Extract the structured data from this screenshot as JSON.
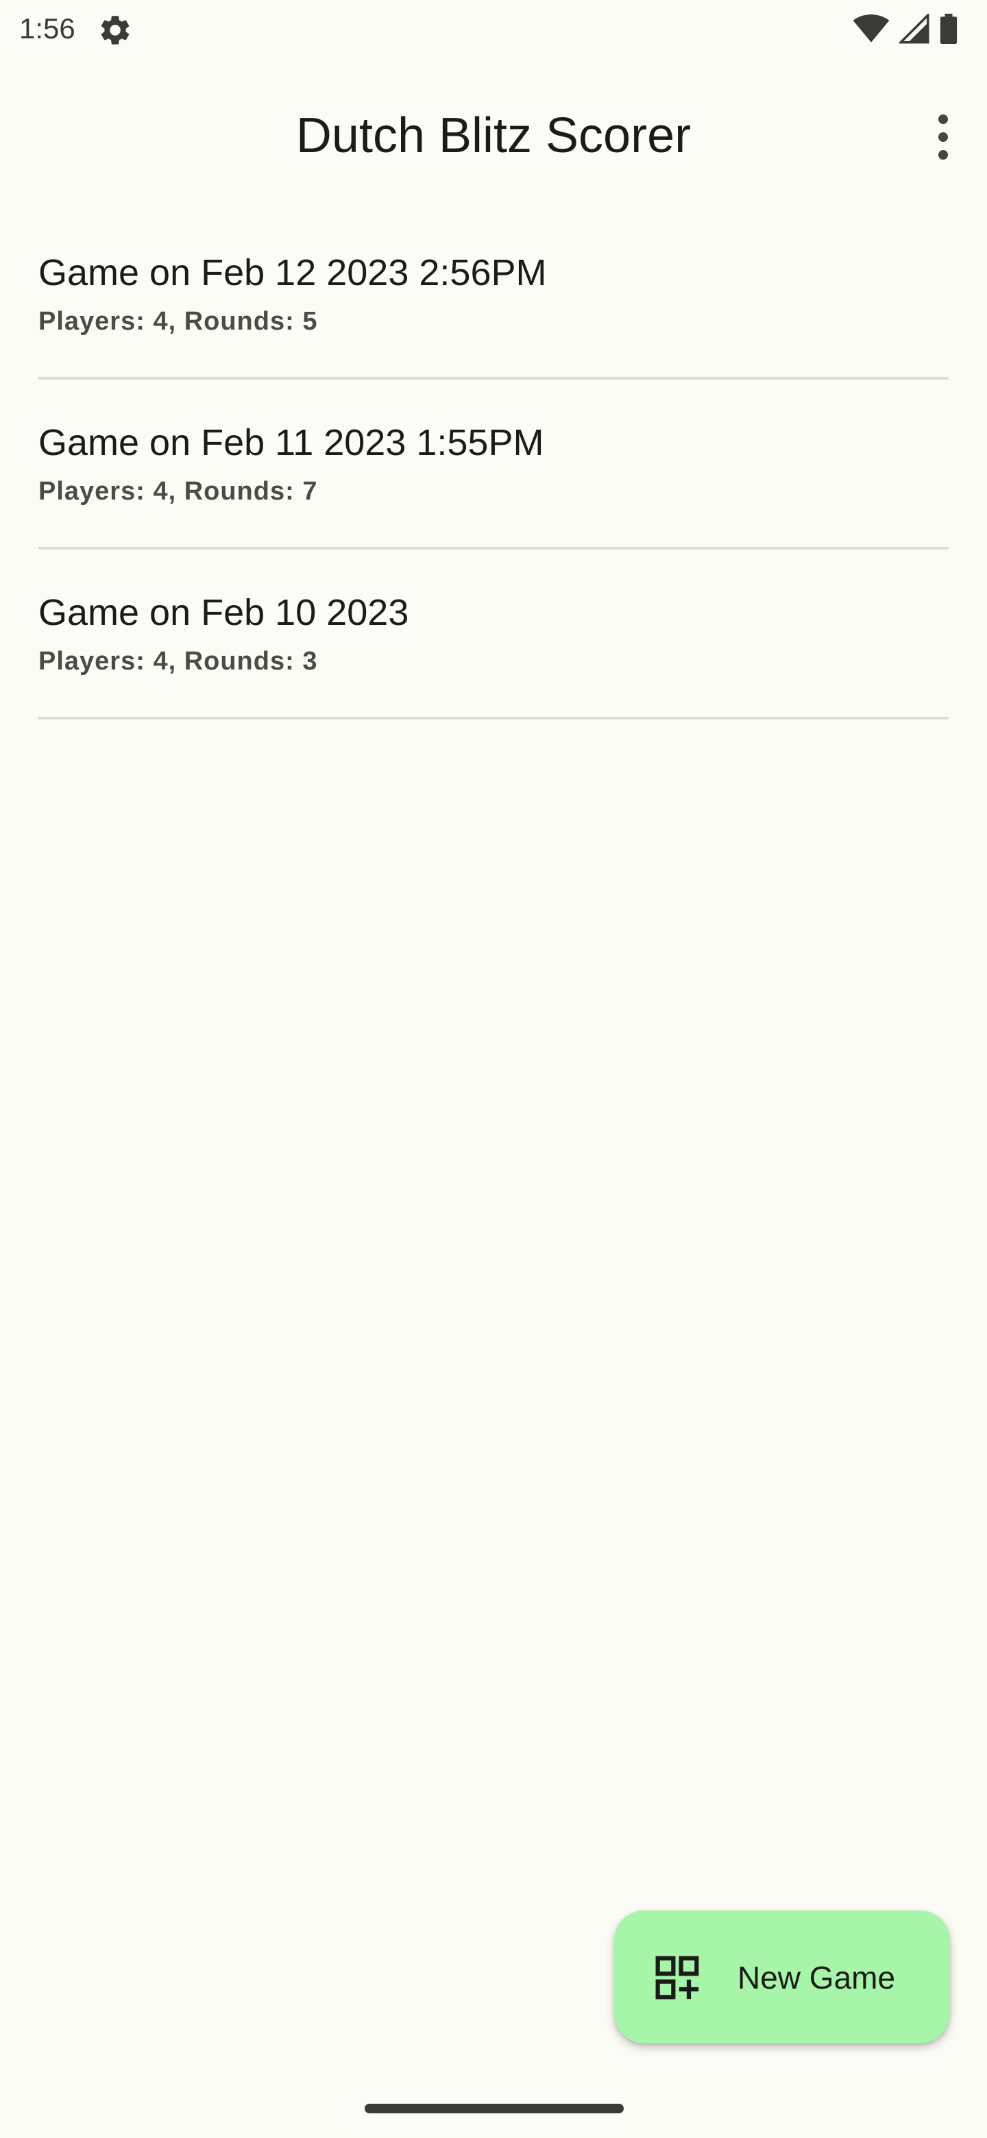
{
  "status_bar": {
    "time": "1:56",
    "icons": [
      "settings-gear-icon",
      "wifi-icon",
      "cell-signal-icon",
      "battery-icon"
    ]
  },
  "app_bar": {
    "title": "Dutch Blitz Scorer",
    "menu_icon": "more-vert-icon"
  },
  "games": [
    {
      "title": "Game on Feb 12 2023 2:56PM",
      "meta": "Players: 4, Rounds: 5"
    },
    {
      "title": "Game on Feb 11 2023 1:55PM",
      "meta": "Players: 4, Rounds: 7"
    },
    {
      "title": "Game on Feb 10 2023",
      "meta": "Players: 4, Rounds: 3"
    }
  ],
  "fab": {
    "label": "New Game",
    "icon": "add-grid-icon"
  },
  "colors": {
    "background": "#fcfcf7",
    "fab": "#a6f5a9",
    "divider": "#dcdcd6",
    "text": "#1b1c18"
  }
}
